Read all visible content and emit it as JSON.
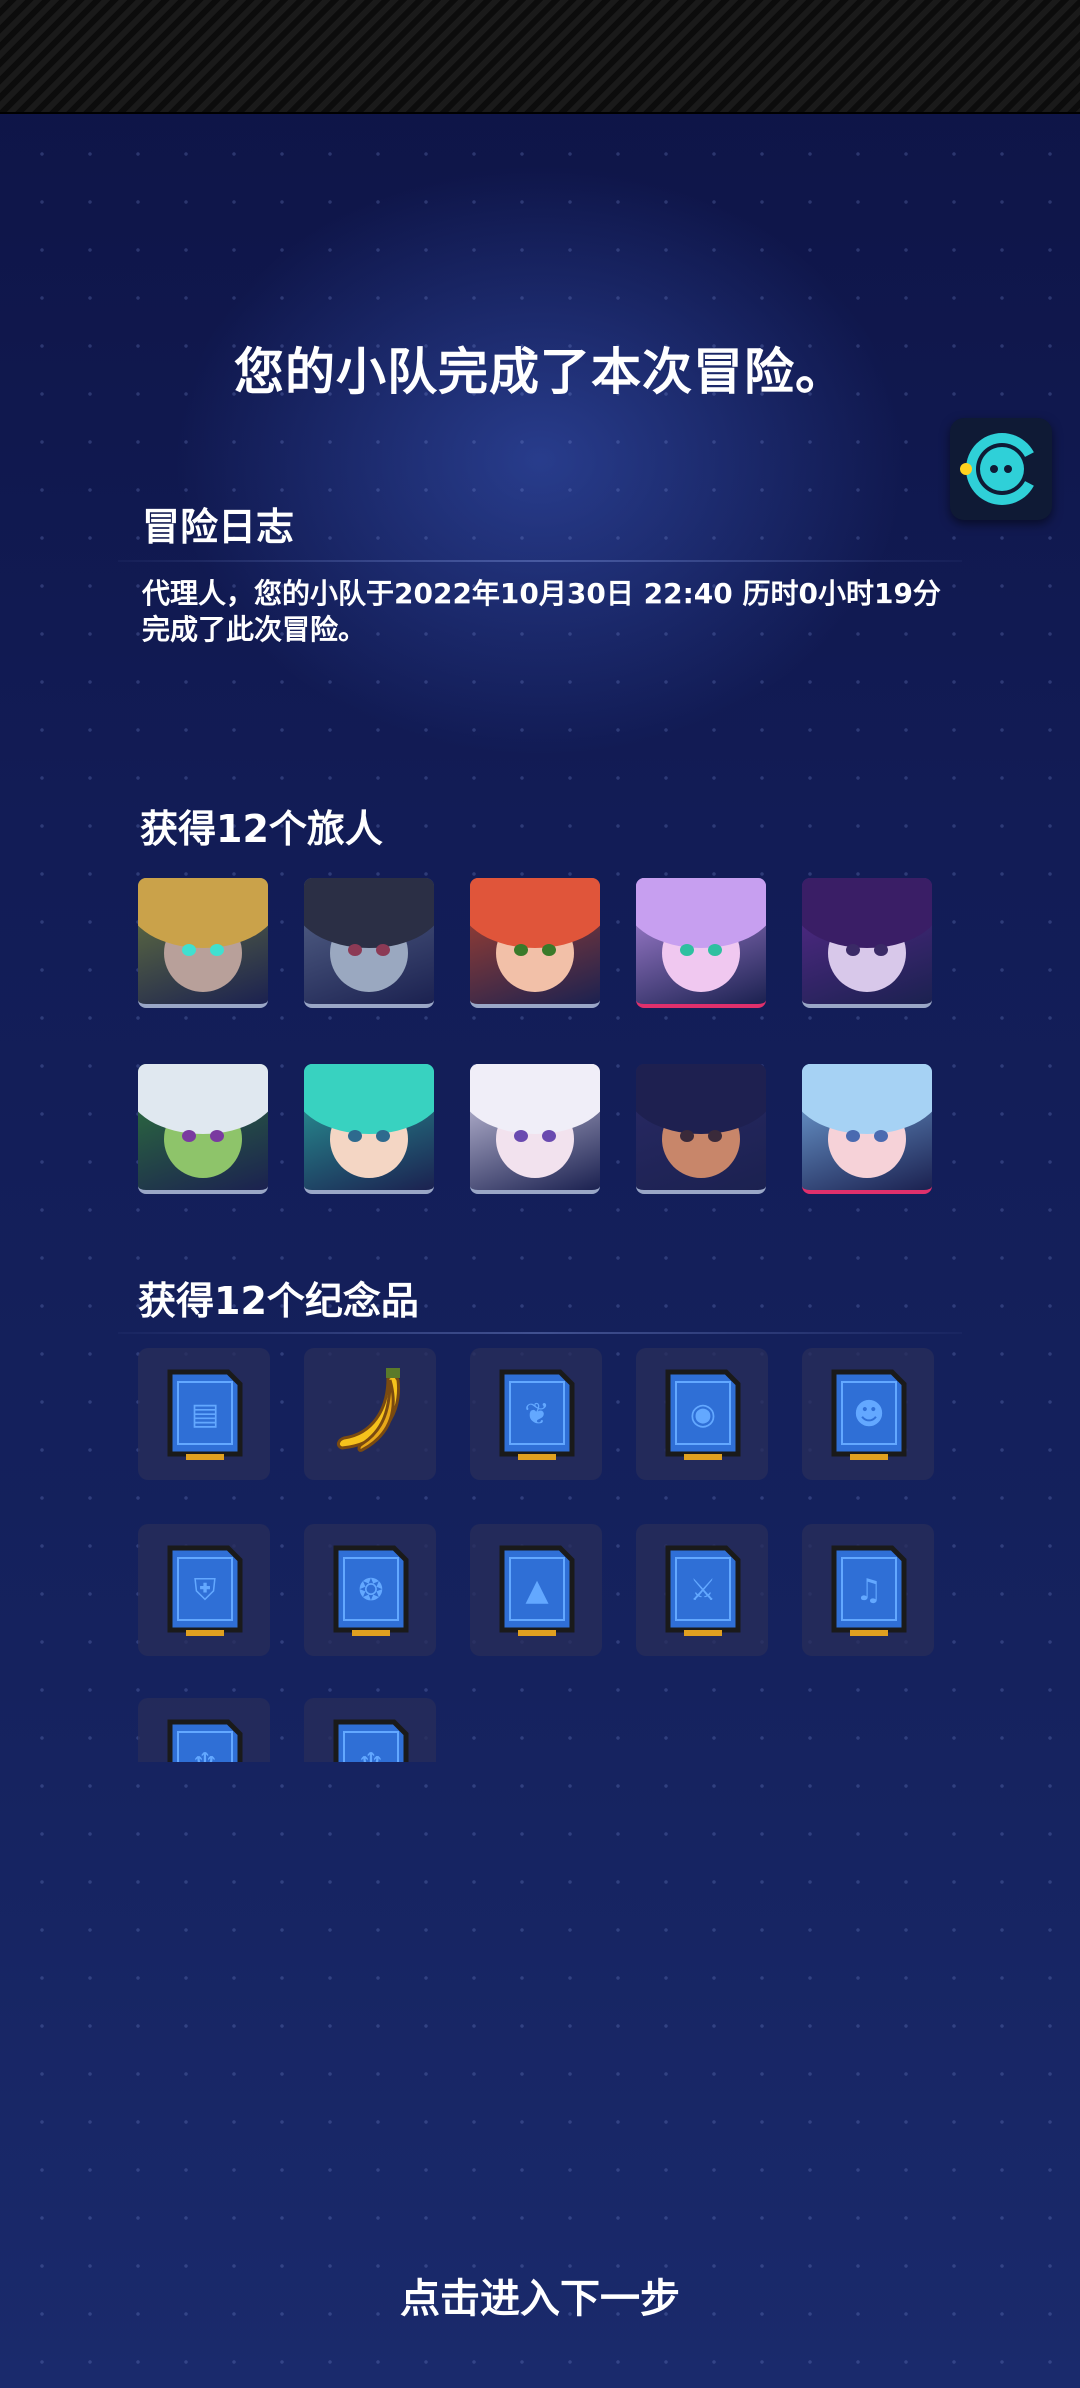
{
  "header": {
    "title": "您的小队完成了本次冒险。"
  },
  "adventure_log": {
    "heading": "冒险日志",
    "text": "代理人，您的小队于2022年10月30日 22:40 历时0小时19分完成了此次冒险。"
  },
  "travelers": {
    "heading": "获得12个旅人",
    "items": [
      {
        "bg": "#6b7a3c",
        "hair": "#caa24a",
        "face": "#b8a09a",
        "eye": "#40e0d0",
        "rare": false
      },
      {
        "bg": "#5b6a8e",
        "hair": "#2b2f45",
        "face": "#9aa8c0",
        "eye": "#8c3a55",
        "rare": false
      },
      {
        "bg": "#b3442c",
        "hair": "#e0553a",
        "face": "#f2c0a8",
        "eye": "#3a7a2a",
        "rare": false
      },
      {
        "bg": "#b88fe6",
        "hair": "#c79ff0",
        "face": "#f0c8f0",
        "eye": "#2ec0a0",
        "rare": true
      },
      {
        "bg": "#5b2a8e",
        "hair": "#3a1e66",
        "face": "#d8c8ea",
        "eye": "#3a2a66",
        "rare": false
      },
      {
        "bg": "#2f7a3a",
        "hair": "#e0e8f0",
        "face": "#8ec46a",
        "eye": "#7a3aa0",
        "rare": false
      },
      {
        "bg": "#2aa7a0",
        "hair": "#38d2c0",
        "face": "#f4d6c4",
        "eye": "#2e6a8e",
        "rare": false
      },
      {
        "bg": "#d8d4ec",
        "hair": "#f0eef8",
        "face": "#f2e2ee",
        "eye": "#6a4ab0",
        "rare": false
      },
      {
        "bg": "#2a2a66",
        "hair": "#1e2050",
        "face": "#c8866a",
        "eye": "#3a2a3a",
        "rare": false
      },
      {
        "bg": "#7ab0e6",
        "hair": "#a6d2f4",
        "face": "#f6d2d8",
        "eye": "#4a6ab0",
        "rare": true
      }
    ]
  },
  "souvenirs": {
    "heading": "获得12个纪念品",
    "items": [
      {
        "icon": "document-card-icon",
        "glyph": "▤"
      },
      {
        "icon": "banana-icon",
        "glyph": ""
      },
      {
        "icon": "ear-card-icon",
        "glyph": "❦"
      },
      {
        "icon": "eye-card-icon",
        "glyph": "◉"
      },
      {
        "icon": "head-card-icon",
        "glyph": "☻"
      },
      {
        "icon": "shield-card-icon",
        "glyph": "⛨"
      },
      {
        "icon": "brain-card-icon",
        "glyph": "❂"
      },
      {
        "icon": "rocket-card-icon",
        "glyph": "▲"
      },
      {
        "icon": "sword-card-icon",
        "glyph": "⚔"
      },
      {
        "icon": "trumpet-card-icon",
        "glyph": "♫"
      },
      {
        "icon": "cup-card-icon",
        "glyph": "♆"
      },
      {
        "icon": "cup-card-icon",
        "glyph": "♆"
      }
    ]
  },
  "footer": {
    "next_label": "点击进入下一步"
  },
  "colors": {
    "card_blue": "#2f6fd6",
    "card_light": "#63a8ff",
    "card_border": "#1a1a1a",
    "rare_border": "#e0306c",
    "chat_cyan": "#2fd0d8"
  }
}
